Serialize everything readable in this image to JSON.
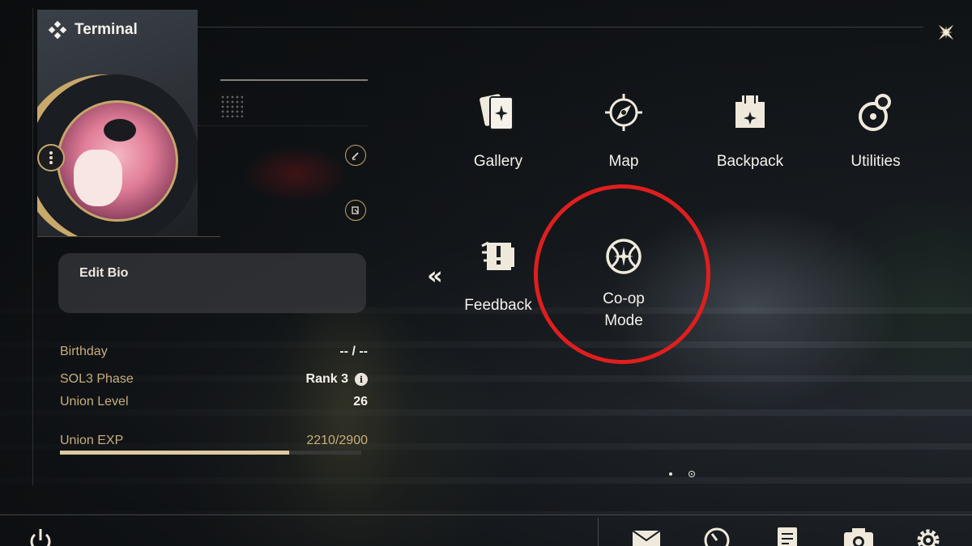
{
  "header": {
    "title": "Terminal",
    "title_icon": "diamond-cluster-icon",
    "close_icon": "close-star-icon"
  },
  "profile": {
    "more_icon": "vertical-dots-icon",
    "edit_icon": "pencil-icon",
    "copy_icon": "copy-icon",
    "bio_label": "Edit Bio",
    "rows": [
      {
        "label": "Birthday",
        "value": "-- / --"
      },
      {
        "label": "SOL3 Phase",
        "value": "Rank 3"
      },
      {
        "label": "Union Level",
        "value": "26"
      }
    ],
    "phase_info_icon": "i",
    "exp": {
      "label": "Union EXP",
      "value": "2210/2900",
      "current": 2210,
      "max": 2900
    }
  },
  "menu": {
    "collapse_icon": "«",
    "items": [
      {
        "label": "Gallery",
        "icon": "cards-icon"
      },
      {
        "label": "Map",
        "icon": "compass-icon"
      },
      {
        "label": "Backpack",
        "icon": "backpack-icon"
      },
      {
        "label": "Utilities",
        "icon": "utilities-icon"
      },
      {
        "label": "Feedback",
        "icon": "feedback-icon"
      },
      {
        "label": "Co-op\nMode",
        "icon": "coop-globe-icon"
      }
    ],
    "page_current": 2,
    "page_total": 2
  },
  "bottom_bar": {
    "left": [
      {
        "icon": "power-icon"
      }
    ],
    "right": [
      {
        "icon": "mail-icon"
      },
      {
        "icon": "clock-icon"
      },
      {
        "icon": "notes-icon"
      },
      {
        "icon": "camera-icon"
      },
      {
        "icon": "settings-icon"
      }
    ]
  },
  "colors": {
    "accent_gold": "#c8ad7c",
    "highlight_red": "#e01e1e",
    "text_primary": "#f4f1ea"
  }
}
